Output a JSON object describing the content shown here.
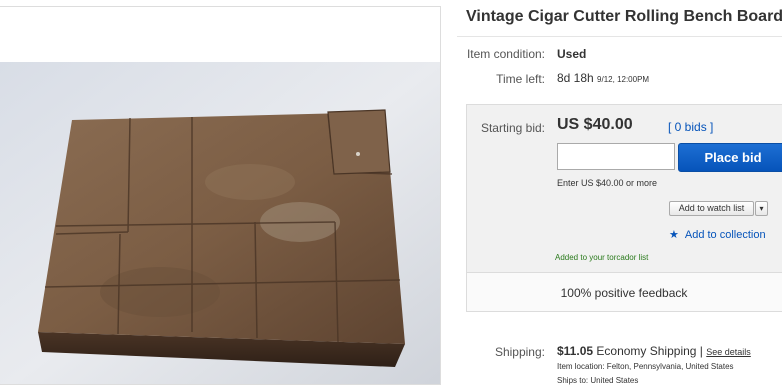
{
  "title": "Vintage Cigar Cutter Rolling Bench Board",
  "condition": {
    "label": "Item condition:",
    "value": "Used"
  },
  "time_left": {
    "label": "Time left:",
    "value": "8d 18h",
    "detail": "9/12, 12:00PM"
  },
  "bid": {
    "label": "Starting bid:",
    "price": "US $40.00",
    "bids_link": "[ 0 bids ]",
    "input_value": "",
    "place_bid": "Place bid",
    "note": "Enter US $40.00 or more",
    "watch_label": "Add to watch list",
    "watch_dropdown": "▾",
    "collection_label": "Add to collection",
    "added_note": "Added to your torcador list"
  },
  "feedback": "100% positive feedback",
  "shipping": {
    "label": "Shipping:",
    "cost": "$11.05",
    "method": "Economy Shipping",
    "separator": "|",
    "details_link": "See details",
    "location": "Item location:  Felton, Pennsylvania, United States",
    "ships_to": "Ships to:  United States"
  },
  "icons": [
    "star-icon",
    "chevron-down-icon"
  ],
  "colors": {
    "link": "#0654ba",
    "button": "#0654ba",
    "added": "#2a7a1c"
  }
}
